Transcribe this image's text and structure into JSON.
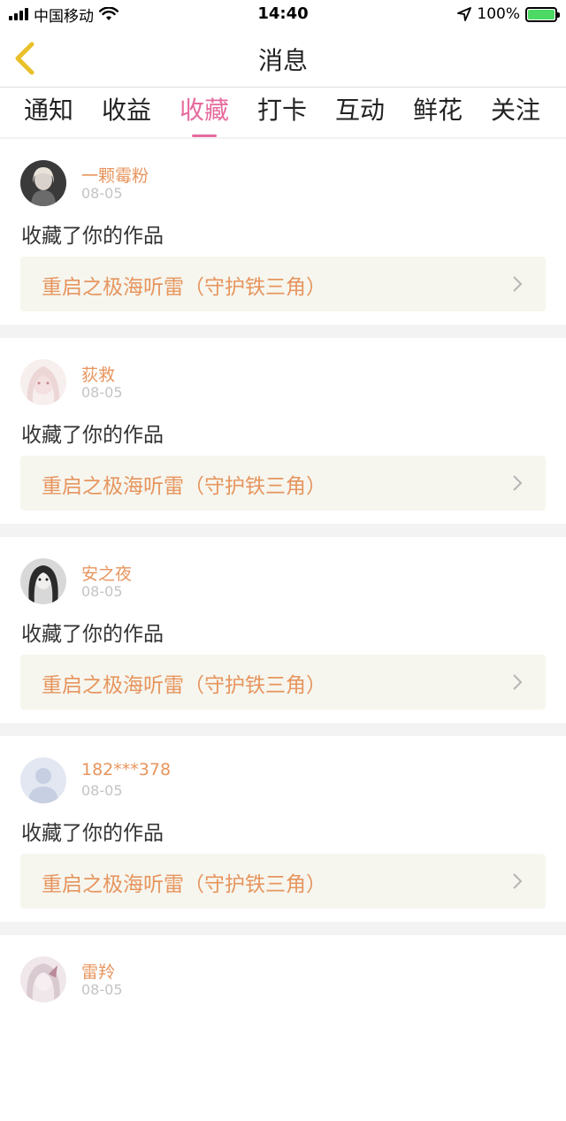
{
  "status_bar": {
    "carrier": "中国移动",
    "time": "14:40",
    "battery": "100%"
  },
  "header": {
    "title": "消息"
  },
  "tabs": [
    {
      "label": "通知",
      "active": false
    },
    {
      "label": "收益",
      "active": false
    },
    {
      "label": "收藏",
      "active": true
    },
    {
      "label": "打卡",
      "active": false
    },
    {
      "label": "互动",
      "active": false
    },
    {
      "label": "鲜花",
      "active": false
    },
    {
      "label": "关注",
      "active": false
    }
  ],
  "colors": {
    "accent": "#e66b9d",
    "name": "#e7955e",
    "work_bg": "#f6f6ef"
  },
  "messages": [
    {
      "user": "一颗霉粉",
      "date": "08-05",
      "action": "收藏了你的作品",
      "work_title": "重启之极海听雷（守护铁三角）"
    },
    {
      "user": "荻救",
      "date": "08-05",
      "action": "收藏了你的作品",
      "work_title": "重启之极海听雷（守护铁三角）"
    },
    {
      "user": "安之夜",
      "date": "08-05",
      "action": "收藏了你的作品",
      "work_title": "重启之极海听雷（守护铁三角）"
    },
    {
      "user": "182***378",
      "date": "08-05",
      "action": "收藏了你的作品",
      "work_title": "重启之极海听雷（守护铁三角）"
    },
    {
      "user": "雷羚",
      "date": "08-05"
    }
  ]
}
